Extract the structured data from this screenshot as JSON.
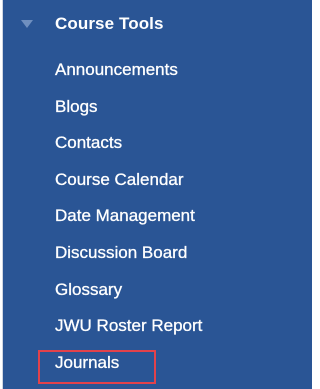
{
  "course_tools": {
    "title": "Course Tools",
    "items": [
      {
        "label": "Announcements"
      },
      {
        "label": "Blogs"
      },
      {
        "label": "Contacts"
      },
      {
        "label": "Course Calendar"
      },
      {
        "label": "Date Management"
      },
      {
        "label": "Discussion Board"
      },
      {
        "label": "Glossary"
      },
      {
        "label": "JWU Roster Report"
      },
      {
        "label": "Journals"
      }
    ],
    "highlighted_item": "Journals"
  },
  "colors": {
    "panel_background": "#2a5595",
    "text": "#ffffff",
    "caret": "#6f8fbf",
    "highlight_border": "#e2424b"
  },
  "icons": {
    "collapse": "caret-down-icon"
  }
}
